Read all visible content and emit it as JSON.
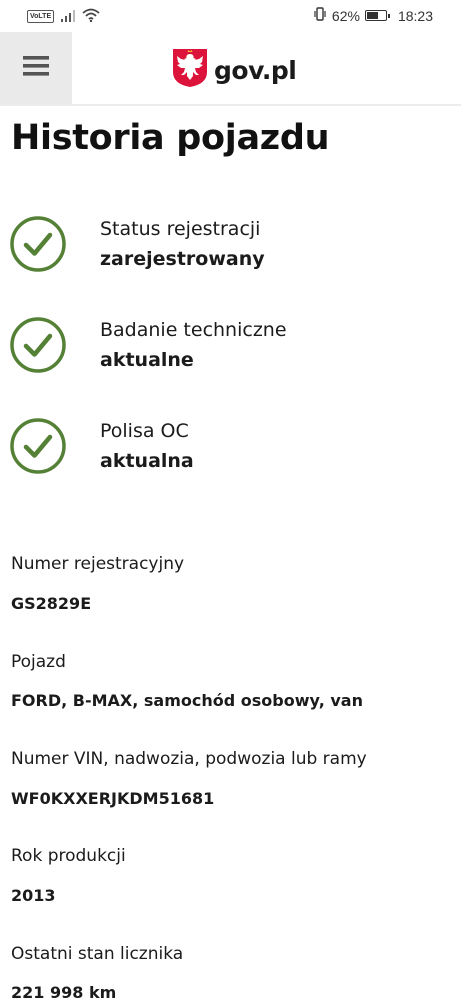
{
  "status_bar": {
    "volte": "VoLTE",
    "battery_percent": "62%",
    "battery_level": 0.62,
    "time": "18:23"
  },
  "header": {
    "brand": "gov.pl",
    "colors": {
      "emblem_red": "#dc143c",
      "menu_bg": "#eaeaea"
    }
  },
  "page": {
    "title": "Historia pojazdu"
  },
  "status_items": [
    {
      "label": "Status rejestracji",
      "value": "zarejestrowany",
      "icon": "check-circle-icon"
    },
    {
      "label": "Badanie techniczne",
      "value": "aktualne",
      "icon": "check-circle-icon"
    },
    {
      "label": "Polisa OC",
      "value": "aktualna",
      "icon": "check-circle-icon"
    }
  ],
  "check_color": "#548135",
  "fields": [
    {
      "label": "Numer rejestracyjny",
      "value": "GS2829E"
    },
    {
      "label": "Pojazd",
      "value": "FORD, B-MAX, samochód osobowy, van"
    },
    {
      "label": "Numer VIN, nadwozia, podwozia lub ramy",
      "value": "WF0KXXERJKDM51681"
    },
    {
      "label": "Rok produkcji",
      "value": "2013"
    },
    {
      "label": "Ostatni stan licznika",
      "value": "221 998 km"
    }
  ]
}
